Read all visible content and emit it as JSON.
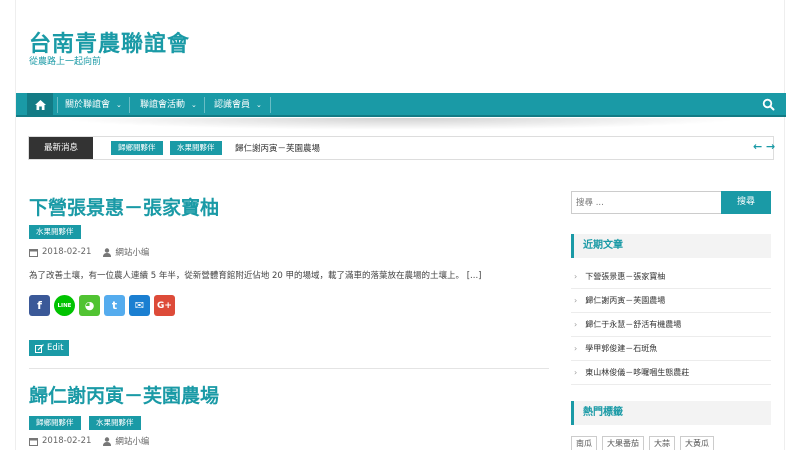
{
  "site": {
    "title": "台南青農聯誼會",
    "description": "從農路上一起向前"
  },
  "nav": {
    "items": [
      "關於聯誼會",
      "聯誼會活動",
      "認識會員"
    ],
    "caret": "⌄"
  },
  "ticker": {
    "label": "最新消息",
    "tags": [
      "歸鄉閱夥伴",
      "水果閱夥伴"
    ],
    "text": "歸仁謝丙寅－芙園農場",
    "prev": "←",
    "next": "→"
  },
  "posts": [
    {
      "title": "下營張景惠－張家寶柚",
      "tags": [
        "水果閱夥伴"
      ],
      "date": "2018-02-21",
      "author": "網站小编",
      "excerpt": "為了改善土壤，有一位農人連續 5 年半，從新營體育館附近佔地 20 甲的場域，載了滿車的落葉放在農場的土壤上。 [...]",
      "edit_label": "Edit"
    },
    {
      "title": "歸仁謝丙寅－芙園農場",
      "tags": [
        "歸鄉閱夥伴",
        "水果閱夥伴"
      ],
      "date": "2018-02-21",
      "author": "網站小编"
    }
  ],
  "share": [
    {
      "name": "facebook",
      "glyph": "f",
      "color": "#3b5998"
    },
    {
      "name": "line",
      "glyph": "LINE",
      "color": "#00c300"
    },
    {
      "name": "wechat",
      "glyph": "◕",
      "color": "#51c332"
    },
    {
      "name": "twitter",
      "glyph": "t",
      "color": "#55acee"
    },
    {
      "name": "email",
      "glyph": "✉",
      "color": "#1b7fd1"
    },
    {
      "name": "google-plus",
      "glyph": "G+",
      "color": "#dd4b39"
    }
  ],
  "sidebar": {
    "search_placeholder": "搜尋 ...",
    "search_button": "搜尋",
    "recent_title": "近期文章",
    "recent": [
      "下營張景惠－張家寶柚",
      "歸仁謝丙寅－芙園農場",
      "歸仁于永慧－舒活有機農場",
      "學甲郭俊建－石斑魚",
      "東山林俊儀－哆囉嘓生態農莊"
    ],
    "tags_title": "熱門標籤",
    "tags": [
      "南瓜",
      "大果番茄",
      "大蒜",
      "大黃瓜"
    ]
  },
  "colors": {
    "accent": "#1a9aa6",
    "accent_dark": "#137b85",
    "ticker_label_bg": "#333333"
  }
}
